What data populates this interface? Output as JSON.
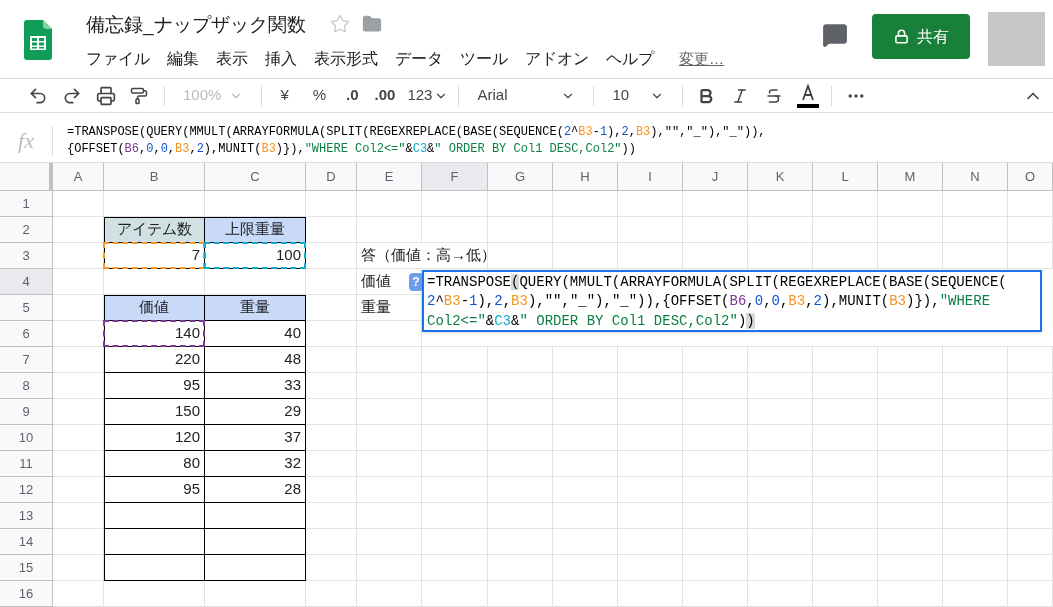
{
  "document": {
    "title": "備忘録_ナップザック関数",
    "starred": false
  },
  "menu": [
    "ファイル",
    "編集",
    "表示",
    "挿入",
    "表示形式",
    "データ",
    "ツール",
    "アドオン",
    "ヘルプ"
  ],
  "last_edit": "変更…",
  "share_button": "共有",
  "toolbar": {
    "zoom": "100%",
    "currency": "¥",
    "percent": "%",
    "decrease_decimal": ".0",
    "increase_decimal": ".00",
    "number_format": "123",
    "font": "Arial",
    "font_size": "10"
  },
  "formula_bar": {
    "label": "fx",
    "lines": [
      [
        {
          "text": "=TRANSPOSE(QUERY(MMULT(ARRAYFORMULA(SPLIT(REGEXREPLACE(BASE(SEQUENCE(",
          "kind": "plain"
        },
        {
          "text": "2",
          "kind": "number"
        },
        {
          "text": "^",
          "kind": "plain"
        },
        {
          "text": "B3",
          "kind": "reference",
          "color": "#f6961e"
        },
        {
          "text": "-",
          "kind": "plain"
        },
        {
          "text": "1",
          "kind": "number"
        },
        {
          "text": "),",
          "kind": "plain"
        },
        {
          "text": "2",
          "kind": "number"
        },
        {
          "text": ",",
          "kind": "plain"
        },
        {
          "text": "B3",
          "kind": "reference",
          "color": "#f6961e"
        },
        {
          "text": "),\"\",\"_\"),\"_\")),",
          "kind": "plain"
        }
      ],
      [
        {
          "text": "{OFFSET(",
          "kind": "plain"
        },
        {
          "text": "B6",
          "kind": "reference",
          "color": "#7e3794"
        },
        {
          "text": ",",
          "kind": "plain"
        },
        {
          "text": "0",
          "kind": "number"
        },
        {
          "text": ",",
          "kind": "plain"
        },
        {
          "text": "0",
          "kind": "number"
        },
        {
          "text": ",",
          "kind": "plain"
        },
        {
          "text": "B3",
          "kind": "reference",
          "color": "#f6961e"
        },
        {
          "text": ",",
          "kind": "plain"
        },
        {
          "text": "2",
          "kind": "number"
        },
        {
          "text": "),MUNIT(",
          "kind": "plain"
        },
        {
          "text": "B3",
          "kind": "reference",
          "color": "#f6961e"
        },
        {
          "text": ")}),",
          "kind": "plain"
        },
        {
          "text": "\"WHERE Col2<=\"",
          "kind": "string"
        },
        {
          "text": "&",
          "kind": "plain"
        },
        {
          "text": "C3",
          "kind": "reference",
          "color": "#11a9cc"
        },
        {
          "text": "&",
          "kind": "plain"
        },
        {
          "text": "\" ORDER BY Col1 DESC,Col2\"",
          "kind": "string"
        },
        {
          "text": "))",
          "kind": "plain"
        }
      ]
    ]
  },
  "columns": [
    {
      "label": "A",
      "selected": false
    },
    {
      "label": "B",
      "selected": false
    },
    {
      "label": "C",
      "selected": false
    },
    {
      "label": "D",
      "selected": false
    },
    {
      "label": "E",
      "selected": false
    },
    {
      "label": "F",
      "selected": true
    },
    {
      "label": "G",
      "selected": false
    },
    {
      "label": "H",
      "selected": false
    },
    {
      "label": "I",
      "selected": false
    },
    {
      "label": "J",
      "selected": false
    },
    {
      "label": "K",
      "selected": false
    },
    {
      "label": "L",
      "selected": false
    },
    {
      "label": "M",
      "selected": false
    },
    {
      "label": "N",
      "selected": false
    },
    {
      "label": "O",
      "selected": false
    }
  ],
  "rows": [
    {
      "number": "1",
      "selected": false,
      "cells": []
    },
    {
      "number": "2",
      "selected": false,
      "cells": [
        {
          "kind": "empty",
          "bordered": false
        },
        {
          "text": "アイテム数",
          "kind": "header",
          "bordered": true,
          "color": "#d0e0e3"
        },
        {
          "text": "上限重量",
          "kind": "header",
          "bordered": true,
          "color": "#c9daf8"
        }
      ]
    },
    {
      "number": "3",
      "selected": false,
      "cells": [
        {
          "kind": "empty",
          "bordered": false
        },
        {
          "text": "7",
          "kind": "number",
          "bordered": true,
          "outline": {
            "color": "#f6961e"
          }
        },
        {
          "text": "100",
          "kind": "number",
          "bordered": true,
          "outline": {
            "color": "#11a9cc"
          }
        },
        {
          "kind": "empty",
          "bordered": false
        },
        {
          "text": "答（価値：高→低）",
          "kind": "overflow_text",
          "bordered": false
        }
      ]
    },
    {
      "number": "4",
      "selected": true,
      "cells": [
        {
          "kind": "empty",
          "bordered": false
        },
        {
          "kind": "empty",
          "bordered": false
        },
        {
          "kind": "empty",
          "bordered": false
        },
        {
          "kind": "empty",
          "bordered": false
        },
        {
          "text": "価値",
          "kind": "text",
          "bordered": false
        }
      ]
    },
    {
      "number": "5",
      "selected": false,
      "cells": [
        {
          "kind": "empty",
          "bordered": false
        },
        {
          "text": "価値",
          "kind": "header",
          "bordered": true,
          "color": "#c9daf8"
        },
        {
          "text": "重量",
          "kind": "header",
          "bordered": true,
          "color": "#c9daf8"
        },
        {
          "kind": "empty",
          "bordered": false
        },
        {
          "text": "重量",
          "kind": "text",
          "bordered": false
        }
      ]
    },
    {
      "number": "6",
      "selected": false,
      "cells": [
        {
          "kind": "empty",
          "bordered": false
        },
        {
          "text": "140",
          "kind": "number",
          "bordered": true,
          "outline": {
            "color": "#7e3794"
          }
        },
        {
          "text": "40",
          "kind": "number",
          "bordered": true
        }
      ]
    },
    {
      "number": "7",
      "selected": false,
      "cells": [
        {
          "kind": "empty",
          "bordered": false
        },
        {
          "text": "220",
          "kind": "number",
          "bordered": true
        },
        {
          "text": "48",
          "kind": "number",
          "bordered": true
        }
      ]
    },
    {
      "number": "8",
      "selected": false,
      "cells": [
        {
          "kind": "empty",
          "bordered": false
        },
        {
          "text": "95",
          "kind": "number",
          "bordered": true
        },
        {
          "text": "33",
          "kind": "number",
          "bordered": true
        }
      ]
    },
    {
      "number": "9",
      "selected": false,
      "cells": [
        {
          "kind": "empty",
          "bordered": false
        },
        {
          "text": "150",
          "kind": "number",
          "bordered": true
        },
        {
          "text": "29",
          "kind": "number",
          "bordered": true
        }
      ]
    },
    {
      "number": "10",
      "selected": false,
      "cells": [
        {
          "kind": "empty",
          "bordered": false
        },
        {
          "text": "120",
          "kind": "number",
          "bordered": true
        },
        {
          "text": "37",
          "kind": "number",
          "bordered": true
        }
      ]
    },
    {
      "number": "11",
      "selected": false,
      "cells": [
        {
          "kind": "empty",
          "bordered": false
        },
        {
          "text": "80",
          "kind": "number",
          "bordered": true
        },
        {
          "text": "32",
          "kind": "number",
          "bordered": true
        }
      ]
    },
    {
      "number": "12",
      "selected": false,
      "cells": [
        {
          "kind": "empty",
          "bordered": false
        },
        {
          "text": "95",
          "kind": "number",
          "bordered": true
        },
        {
          "text": "28",
          "kind": "number",
          "bordered": true
        }
      ]
    },
    {
      "number": "13",
      "selected": false,
      "cells": [
        {
          "kind": "empty",
          "bordered": false
        },
        {
          "kind": "empty",
          "bordered": true
        },
        {
          "kind": "empty",
          "bordered": true
        }
      ]
    },
    {
      "number": "14",
      "selected": false,
      "cells": [
        {
          "kind": "empty",
          "bordered": false
        },
        {
          "kind": "empty",
          "bordered": true
        },
        {
          "kind": "empty",
          "bordered": true
        }
      ]
    },
    {
      "number": "15",
      "selected": false,
      "cells": [
        {
          "kind": "empty",
          "bordered": false
        },
        {
          "kind": "empty",
          "bordered": true
        },
        {
          "kind": "empty",
          "bordered": true
        }
      ]
    },
    {
      "number": "16",
      "selected": false,
      "cells": []
    }
  ],
  "editor": {
    "help": "?",
    "lines": [
      [
        {
          "text": "=TRANSPOSE",
          "kind": "plain",
          "highlighted": false
        },
        {
          "text": "(",
          "kind": "plain",
          "highlighted": true
        },
        {
          "text": "QUERY(MMULT(ARRAYFORMULA(SPLIT(REGEXREPLACE(BASE(SEQUENCE(",
          "kind": "plain",
          "highlighted": false
        }
      ],
      [
        {
          "text": "2",
          "kind": "number",
          "highlighted": false
        },
        {
          "text": "^",
          "kind": "plain",
          "highlighted": false
        },
        {
          "text": "B3",
          "kind": "reference",
          "color": "#f6961e",
          "highlighted": false
        },
        {
          "text": "-",
          "kind": "plain",
          "highlighted": false
        },
        {
          "text": "1",
          "kind": "number",
          "highlighted": false
        },
        {
          "text": "),",
          "kind": "plain",
          "highlighted": false
        },
        {
          "text": "2",
          "kind": "number",
          "highlighted": false
        },
        {
          "text": ",",
          "kind": "plain",
          "highlighted": false
        },
        {
          "text": "B3",
          "kind": "reference",
          "color": "#f6961e",
          "highlighted": false
        },
        {
          "text": "),\"\",\"_\"),\"_\")),{OFFSET(",
          "kind": "plain",
          "highlighted": false
        },
        {
          "text": "B6",
          "kind": "reference",
          "color": "#7e3794",
          "highlighted": false
        },
        {
          "text": ",",
          "kind": "plain",
          "highlighted": false
        },
        {
          "text": "0",
          "kind": "number",
          "highlighted": false
        },
        {
          "text": ",",
          "kind": "plain",
          "highlighted": false
        },
        {
          "text": "0",
          "kind": "number",
          "highlighted": false
        },
        {
          "text": ",",
          "kind": "plain",
          "highlighted": false
        },
        {
          "text": "B3",
          "kind": "reference",
          "color": "#f6961e",
          "highlighted": false
        },
        {
          "text": ",",
          "kind": "plain",
          "highlighted": false
        },
        {
          "text": "2",
          "kind": "number",
          "highlighted": false
        },
        {
          "text": "),MUNIT(",
          "kind": "plain",
          "highlighted": false
        },
        {
          "text": "B3",
          "kind": "reference",
          "color": "#f6961e",
          "highlighted": false
        },
        {
          "text": ")}),",
          "kind": "plain",
          "highlighted": false
        },
        {
          "text": "\"WHERE",
          "kind": "string",
          "highlighted": false
        }
      ],
      [
        {
          "text": "Col2<=\"",
          "kind": "string",
          "highlighted": false
        },
        {
          "text": "&",
          "kind": "plain",
          "highlighted": false
        },
        {
          "text": "C3",
          "kind": "reference",
          "color": "#11a9cc",
          "highlighted": false
        },
        {
          "text": "&",
          "kind": "plain",
          "highlighted": false
        },
        {
          "text": "\" ORDER BY Col1 DESC,Col2\"",
          "kind": "string",
          "highlighted": false
        },
        {
          "text": ")",
          "kind": "plain",
          "highlighted": false
        },
        {
          "text": ")",
          "kind": "plain",
          "highlighted": true
        }
      ]
    ]
  }
}
